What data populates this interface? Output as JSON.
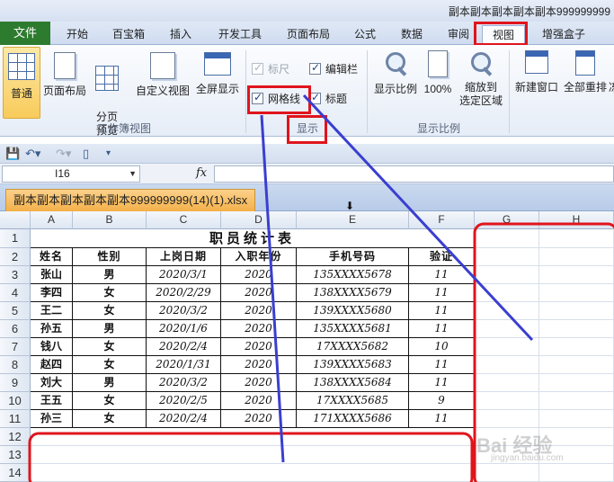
{
  "window": {
    "title": "副本副本副本副本副本999999999"
  },
  "tabs": [
    {
      "label": "文件"
    },
    {
      "label": "开始"
    },
    {
      "label": "百宝箱"
    },
    {
      "label": "插入"
    },
    {
      "label": "开发工具"
    },
    {
      "label": "页面布局"
    },
    {
      "label": "公式"
    },
    {
      "label": "数据"
    },
    {
      "label": "审阅"
    },
    {
      "label": "视图"
    },
    {
      "label": "增强盒子"
    }
  ],
  "ribbon": {
    "views": [
      {
        "label": "普通"
      },
      {
        "label": "页面布局"
      },
      {
        "label": "分页\n预览"
      },
      {
        "label": "自定义视图"
      },
      {
        "label": "全屏显示"
      }
    ],
    "group_views": "工作簿视图",
    "show": {
      "ruler": "标尺",
      "formula_bar": "编辑栏",
      "gridlines": "网格线",
      "headings": "标题",
      "group": "显示"
    },
    "zoom": {
      "zoom": "显示比例",
      "hundred": "100%",
      "selection_line1": "缩放到",
      "selection_line2": "选定区域",
      "group": "显示比例"
    },
    "window": {
      "new_window": "新建窗口",
      "arrange_all": "全部重排",
      "more": "冻"
    }
  },
  "formula_bar": {
    "name_box": "I16",
    "fx": "fx"
  },
  "workbook": {
    "tab": "副本副本副本副本副本999999999(14)(1).xlsx"
  },
  "sheet": {
    "columns": [
      "A",
      "B",
      "C",
      "D",
      "E",
      "F",
      "G",
      "H"
    ],
    "rows": [
      "1",
      "2",
      "3",
      "4",
      "5",
      "6",
      "7",
      "8",
      "9",
      "10",
      "11",
      "12",
      "13",
      "14"
    ],
    "title": "职员统计表",
    "headers": [
      "姓名",
      "性别",
      "上岗日期",
      "入职年份",
      "手机号码",
      "验证"
    ],
    "data": [
      [
        "张山",
        "男",
        "2020/3/1",
        "2020",
        "135XXXX5678",
        "11"
      ],
      [
        "李四",
        "女",
        "2020/2/29",
        "2020",
        "138XXXX5679",
        "11"
      ],
      [
        "王二",
        "女",
        "2020/3/2",
        "2020",
        "139XXXX5680",
        "11"
      ],
      [
        "孙五",
        "男",
        "2020/1/6",
        "2020",
        "135XXXX5681",
        "11"
      ],
      [
        "钱八",
        "女",
        "2020/2/4",
        "2020",
        "17XXXX5682",
        "10"
      ],
      [
        "赵四",
        "女",
        "2020/1/31",
        "2020",
        "139XXXX5683",
        "11"
      ],
      [
        "刘大",
        "男",
        "2020/3/2",
        "2020",
        "138XXXX5684",
        "11"
      ],
      [
        "王五",
        "女",
        "2020/2/5",
        "2020",
        "17XXXX5685",
        "9"
      ],
      [
        "孙三",
        "女",
        "2020/2/4",
        "2020",
        "171XXXX5686",
        "11"
      ]
    ]
  },
  "watermark": {
    "text": "Bai 经验",
    "sub": "jingyan.baidu.com"
  },
  "colors": {
    "file_tab": "#2d7b2f",
    "highlight": "#e0141c",
    "annotation": "#3a3fcf",
    "selected_button": "#f8cb5b"
  }
}
